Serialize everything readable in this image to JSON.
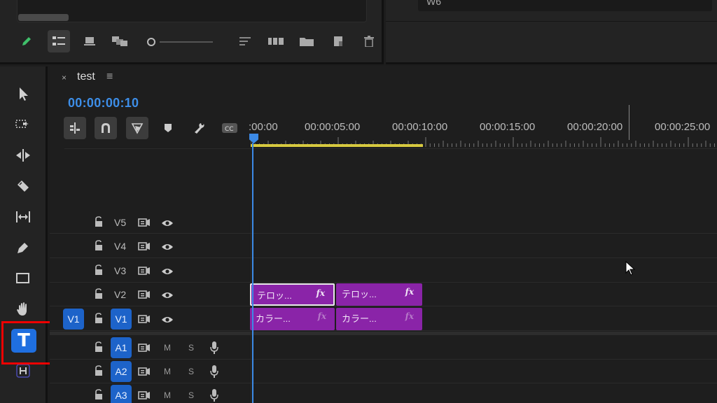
{
  "source_monitor": {
    "dropdown_value": "W6"
  },
  "sequence": {
    "tab_name": "test",
    "close_symbol": "×",
    "menu_symbol": "≡",
    "timecode": "00:00:00:10"
  },
  "ruler": {
    "labels": [
      ":00:00",
      "00:00:05:00",
      "00:00:10:00",
      "00:00:15:00",
      "00:00:20:00",
      "00:00:25:00"
    ]
  },
  "tracks": {
    "video": [
      {
        "name": "V5"
      },
      {
        "name": "V4"
      },
      {
        "name": "V3"
      },
      {
        "name": "V2"
      },
      {
        "name": "V1",
        "source": "V1"
      }
    ],
    "audio": [
      {
        "name": "A1",
        "m": "M",
        "s": "S"
      },
      {
        "name": "A2",
        "m": "M",
        "s": "S"
      },
      {
        "name": "A3",
        "m": "M",
        "s": "S"
      }
    ]
  },
  "clips": {
    "v2": [
      {
        "name": "テロッ...",
        "fx": "fx"
      },
      {
        "name": "テロッ...",
        "fx": "fx"
      }
    ],
    "v1": [
      {
        "name": "カラー...",
        "fx": "fx"
      },
      {
        "name": "カラー...",
        "fx": "fx"
      }
    ]
  },
  "tools": {
    "type_tool_glyph": "T"
  },
  "colors": {
    "accent": "#3c8ae6",
    "clip": "#8a24a8",
    "work_area": "#d7c93f",
    "highlight": "#e00000"
  }
}
